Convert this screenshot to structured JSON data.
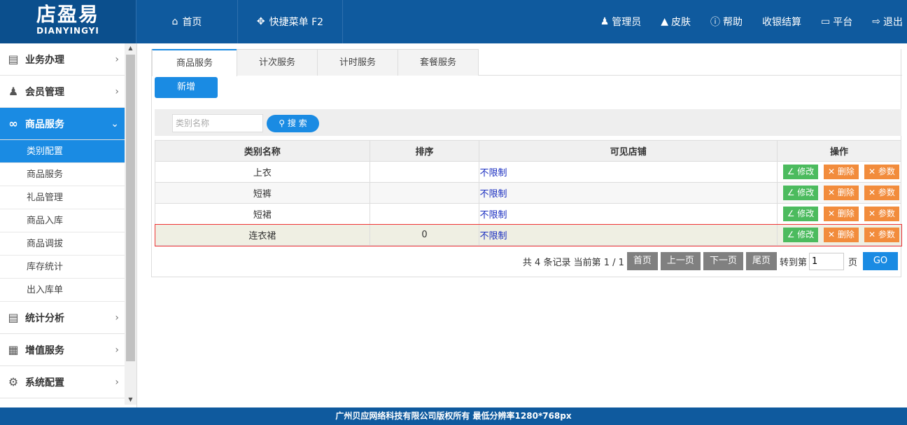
{
  "header": {
    "logo_top": "店盈易",
    "logo_bottom": "DIANYINGYI",
    "nav": [
      {
        "label": "首页",
        "icon": "home-icon"
      },
      {
        "label": "快捷菜单 F2",
        "icon": "move-icon"
      }
    ],
    "right": [
      {
        "label": "管理员",
        "icon": "user-icon"
      },
      {
        "label": "皮肤",
        "icon": "shirt-icon"
      },
      {
        "label": "帮助",
        "icon": "help-icon"
      },
      {
        "label": "收银结算",
        "icon": ""
      },
      {
        "label": "平台",
        "icon": "monitor-icon"
      },
      {
        "label": "退出",
        "icon": "logout-icon"
      }
    ]
  },
  "sidebar": {
    "items": [
      {
        "label": "业务办理"
      },
      {
        "label": "会员管理"
      },
      {
        "label": "商品服务"
      },
      {
        "label": "统计分析"
      },
      {
        "label": "增值服务"
      },
      {
        "label": "系统配置"
      }
    ],
    "sub": [
      "类别配置",
      "商品服务",
      "礼品管理",
      "商品入库",
      "商品调拔",
      "库存统计",
      "出入库单"
    ]
  },
  "tabs": [
    "商品服务",
    "计次服务",
    "计时服务",
    "套餐服务"
  ],
  "toolbar": {
    "add_label": "新增"
  },
  "search": {
    "placeholder": "类别名称",
    "button": "搜 索"
  },
  "table": {
    "headers": [
      "类别名称",
      "排序",
      "可见店铺",
      "操作"
    ],
    "rows": [
      {
        "name": "上衣",
        "order": "",
        "shop": "不限制"
      },
      {
        "name": "短裤",
        "order": "",
        "shop": "不限制"
      },
      {
        "name": "短裙",
        "order": "",
        "shop": "不限制"
      },
      {
        "name": "连衣裙",
        "order": "0",
        "shop": "不限制"
      }
    ],
    "ops": {
      "edit": "修改",
      "delete": "删除",
      "param": "参数"
    }
  },
  "pager": {
    "summary": "共 4 条记录 当前第 1 / 1",
    "first": "首页",
    "prev": "上一页",
    "next": "下一页",
    "last": "尾页",
    "goto_label": "转到第",
    "page_value": "1",
    "page_unit": "页",
    "go": "GO"
  },
  "footer": {
    "text": "广州贝应网络科技有限公司版权所有 最低分辨率1280*768px"
  },
  "colors": {
    "header": "#0f5a9e",
    "accent": "#1a8be3",
    "edit": "#4cbb5e",
    "delete": "#f28c3c"
  }
}
